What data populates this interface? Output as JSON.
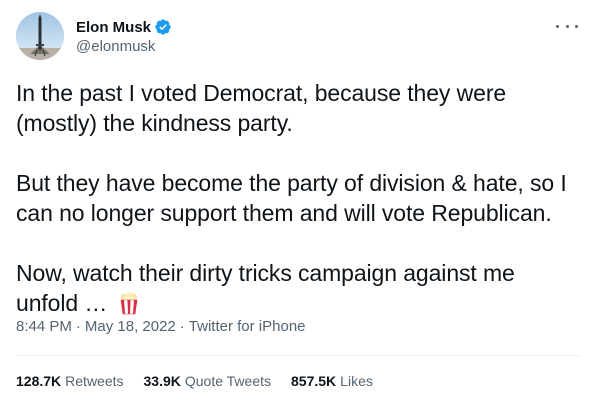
{
  "user": {
    "display_name": "Elon Musk",
    "handle": "@elonmusk",
    "verified": true,
    "verified_color": "#1d9bf0",
    "avatar_icon": "rocket-avatar"
  },
  "tweet": {
    "paragraphs": [
      "In the past I voted Democrat, because they were (mostly) the kindness party.",
      "But they have become the party of division & hate, so I can no longer support them and will vote Republican.",
      "Now, watch their dirty tricks campaign against me unfold … "
    ],
    "emoji": "popcorn-icon",
    "time": "8:44 PM",
    "date": "May 18, 2022",
    "separator": "·",
    "source": "Twitter for iPhone"
  },
  "stats": {
    "retweets_count": "128.7K",
    "retweets_label": "Retweets",
    "quotes_count": "33.9K",
    "quotes_label": "Quote Tweets",
    "likes_count": "857.5K",
    "likes_label": "Likes"
  },
  "colors": {
    "text_primary": "#0f1419",
    "text_secondary": "#536471",
    "divider": "#eff3f4"
  }
}
